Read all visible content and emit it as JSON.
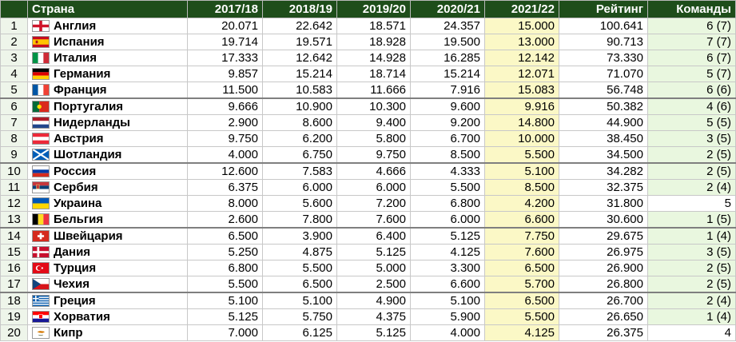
{
  "table": {
    "headers": {
      "num": "",
      "country": "Страна",
      "s1": "2017/18",
      "s2": "2018/19",
      "s3": "2019/20",
      "s4": "2020/21",
      "s5": "2021/22",
      "rating": "Рейтинг",
      "teams": "Команды"
    },
    "colors": {
      "header_bg": "#1e4d1a",
      "season_highlight": "#fbf8c6",
      "teams_highlight": "#e9f7df"
    },
    "rows": [
      {
        "num": "1",
        "flag": "england-flag",
        "country": "Англия",
        "s1": "20.071",
        "s2": "22.642",
        "s3": "18.571",
        "s4": "24.357",
        "s5": "15.000",
        "rating": "100.641",
        "teams": "6 (7)",
        "teams_hl": true
      },
      {
        "num": "2",
        "flag": "spain-flag",
        "country": "Испания",
        "s1": "19.714",
        "s2": "19.571",
        "s3": "18.928",
        "s4": "19.500",
        "s5": "13.000",
        "rating": "90.713",
        "teams": "7 (7)",
        "teams_hl": true
      },
      {
        "num": "3",
        "flag": "italy-flag",
        "country": "Италия",
        "s1": "17.333",
        "s2": "12.642",
        "s3": "14.928",
        "s4": "16.285",
        "s5": "12.142",
        "rating": "73.330",
        "teams": "6 (7)",
        "teams_hl": true
      },
      {
        "num": "4",
        "flag": "germany-flag",
        "country": "Германия",
        "s1": "9.857",
        "s2": "15.214",
        "s3": "18.714",
        "s4": "15.214",
        "s5": "12.071",
        "rating": "71.070",
        "teams": "5 (7)",
        "teams_hl": true
      },
      {
        "num": "5",
        "flag": "france-flag",
        "country": "Франция",
        "s1": "11.500",
        "s2": "10.583",
        "s3": "11.666",
        "s4": "7.916",
        "s5": "15.083",
        "rating": "56.748",
        "teams": "6 (6)",
        "teams_hl": true
      },
      {
        "num": "6",
        "flag": "portugal-flag",
        "country": "Португалия",
        "s1": "9.666",
        "s2": "10.900",
        "s3": "10.300",
        "s4": "9.600",
        "s5": "9.916",
        "rating": "50.382",
        "teams": "4 (6)",
        "teams_hl": true
      },
      {
        "num": "7",
        "flag": "netherlands-flag",
        "country": "Нидерланды",
        "s1": "2.900",
        "s2": "8.600",
        "s3": "9.400",
        "s4": "9.200",
        "s5": "14.800",
        "rating": "44.900",
        "teams": "5 (5)",
        "teams_hl": true
      },
      {
        "num": "8",
        "flag": "austria-flag",
        "country": "Австрия",
        "s1": "9.750",
        "s2": "6.200",
        "s3": "5.800",
        "s4": "6.700",
        "s5": "10.000",
        "rating": "38.450",
        "teams": "3 (5)",
        "teams_hl": true
      },
      {
        "num": "9",
        "flag": "scotland-flag",
        "country": "Шотландия",
        "s1": "4.000",
        "s2": "6.750",
        "s3": "9.750",
        "s4": "8.500",
        "s5": "5.500",
        "rating": "34.500",
        "teams": "2 (5)",
        "teams_hl": true
      },
      {
        "num": "10",
        "flag": "russia-flag",
        "country": "Россия",
        "s1": "12.600",
        "s2": "7.583",
        "s3": "4.666",
        "s4": "4.333",
        "s5": "5.100",
        "rating": "34.282",
        "teams": "2 (5)",
        "teams_hl": true
      },
      {
        "num": "11",
        "flag": "serbia-flag",
        "country": "Сербия",
        "s1": "6.375",
        "s2": "6.000",
        "s3": "6.000",
        "s4": "5.500",
        "s5": "8.500",
        "rating": "32.375",
        "teams": "2 (4)",
        "teams_hl": true
      },
      {
        "num": "12",
        "flag": "ukraine-flag",
        "country": "Украина",
        "s1": "8.000",
        "s2": "5.600",
        "s3": "7.200",
        "s4": "6.800",
        "s5": "4.200",
        "rating": "31.800",
        "teams": "5",
        "teams_hl": false
      },
      {
        "num": "13",
        "flag": "belgium-flag",
        "country": "Бельгия",
        "s1": "2.600",
        "s2": "7.800",
        "s3": "7.600",
        "s4": "6.000",
        "s5": "6.600",
        "rating": "30.600",
        "teams": "1 (5)",
        "teams_hl": true
      },
      {
        "num": "14",
        "flag": "switzerland-flag",
        "country": "Швейцария",
        "s1": "6.500",
        "s2": "3.900",
        "s3": "6.400",
        "s4": "5.125",
        "s5": "7.750",
        "rating": "29.675",
        "teams": "1 (4)",
        "teams_hl": true
      },
      {
        "num": "15",
        "flag": "denmark-flag",
        "country": "Дания",
        "s1": "5.250",
        "s2": "4.875",
        "s3": "5.125",
        "s4": "4.125",
        "s5": "7.600",
        "rating": "26.975",
        "teams": "3 (5)",
        "teams_hl": true
      },
      {
        "num": "16",
        "flag": "turkey-flag",
        "country": "Турция",
        "s1": "6.800",
        "s2": "5.500",
        "s3": "5.000",
        "s4": "3.300",
        "s5": "6.500",
        "rating": "26.900",
        "teams": "2 (5)",
        "teams_hl": true
      },
      {
        "num": "17",
        "flag": "czechia-flag",
        "country": "Чехия",
        "s1": "5.500",
        "s2": "6.500",
        "s3": "2.500",
        "s4": "6.600",
        "s5": "5.700",
        "rating": "26.800",
        "teams": "2 (5)",
        "teams_hl": true
      },
      {
        "num": "18",
        "flag": "greece-flag",
        "country": "Греция",
        "s1": "5.100",
        "s2": "5.100",
        "s3": "4.900",
        "s4": "5.100",
        "s5": "6.500",
        "rating": "26.700",
        "teams": "2 (4)",
        "teams_hl": true
      },
      {
        "num": "19",
        "flag": "croatia-flag",
        "country": "Хорватия",
        "s1": "5.125",
        "s2": "5.750",
        "s3": "4.375",
        "s4": "5.900",
        "s5": "5.500",
        "rating": "26.650",
        "teams": "1 (4)",
        "teams_hl": true
      },
      {
        "num": "20",
        "flag": "cyprus-flag",
        "country": "Кипр",
        "s1": "7.000",
        "s2": "6.125",
        "s3": "5.125",
        "s4": "4.000",
        "s5": "4.125",
        "rating": "26.375",
        "teams": "4",
        "teams_hl": false
      }
    ]
  }
}
